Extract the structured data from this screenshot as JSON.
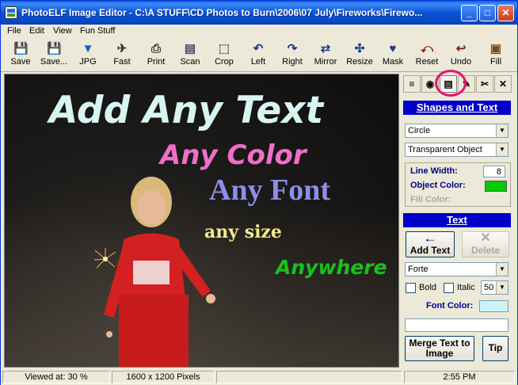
{
  "window": {
    "title": "PhotoELF Image Editor - C:\\A STUFF\\CD Photos to Burn\\2006\\07 July\\Fireworks\\Firewo...",
    "minimize": "_",
    "maximize": "□",
    "close": "✕"
  },
  "menu": [
    "File",
    "Edit",
    "View",
    "Fun Stuff"
  ],
  "toolbar": [
    {
      "label": "Save",
      "icon": "save-icon",
      "glyph": "💾"
    },
    {
      "label": "Save...",
      "icon": "save-as-icon",
      "glyph": "💾"
    },
    {
      "label": "JPG",
      "icon": "jpg-icon",
      "glyph": "▼"
    },
    {
      "label": "Fast",
      "icon": "fast-icon",
      "glyph": "✈"
    },
    {
      "label": "Print",
      "icon": "print-icon",
      "glyph": "⎙"
    },
    {
      "label": "Scan",
      "icon": "scan-icon",
      "glyph": "▤"
    },
    {
      "label": "Crop",
      "icon": "crop-icon",
      "glyph": "⬚"
    },
    {
      "label": "Left",
      "icon": "rotate-left-icon",
      "glyph": "↶"
    },
    {
      "label": "Right",
      "icon": "rotate-right-icon",
      "glyph": "↷"
    },
    {
      "label": "Mirror",
      "icon": "mirror-icon",
      "glyph": "⇄"
    },
    {
      "label": "Resize",
      "icon": "resize-icon",
      "glyph": "✣"
    },
    {
      "label": "Mask",
      "icon": "mask-icon",
      "glyph": "♥"
    },
    {
      "label": "Reset",
      "icon": "reset-icon",
      "glyph": "⤺"
    },
    {
      "label": "Undo",
      "icon": "undo-icon",
      "glyph": "↩"
    },
    {
      "label": "Fill",
      "icon": "fill-icon",
      "glyph": "▣"
    }
  ],
  "canvas_text": {
    "line1": {
      "text": "Add Any Text",
      "color": "#d7f5f3"
    },
    "line2": {
      "text": "Any Color",
      "color": "#f06ec8"
    },
    "line3": {
      "text": "Any Font",
      "color": "#8d8ee8"
    },
    "line4": {
      "text": "any size",
      "color": "#f4e98a"
    },
    "line5": {
      "text": "Anywhere",
      "color": "#18c21a"
    }
  },
  "panel": {
    "tool_icons": [
      "layers-icon",
      "eye-icon",
      "text-tool-icon",
      "paint-icon",
      "scissors-icon",
      "close-icon"
    ],
    "shapes_header": "Shapes and Text",
    "shape_select": "Circle",
    "object_select": "Transparent Object",
    "line_width_label": "Line Width:",
    "line_width_value": "8",
    "object_color_label": "Object Color:",
    "object_color": "#00cc00",
    "fill_color_label": "Fill Color:",
    "text_header": "Text",
    "add_text": "Add Text",
    "delete": "Delete",
    "font_select": "Forte",
    "bold_label": "Bold",
    "italic_label": "Italic",
    "size_select": "50",
    "font_color_label": "Font Color:",
    "font_color": "#cbf5f5",
    "text_input": "",
    "merge_label": "Merge Text to Image",
    "tip_label": "Tip"
  },
  "status": {
    "viewed": "Viewed at: 30 %",
    "dimensions": "1600 x 1200 Pixels",
    "blank": "",
    "time": "2:55 PM"
  }
}
